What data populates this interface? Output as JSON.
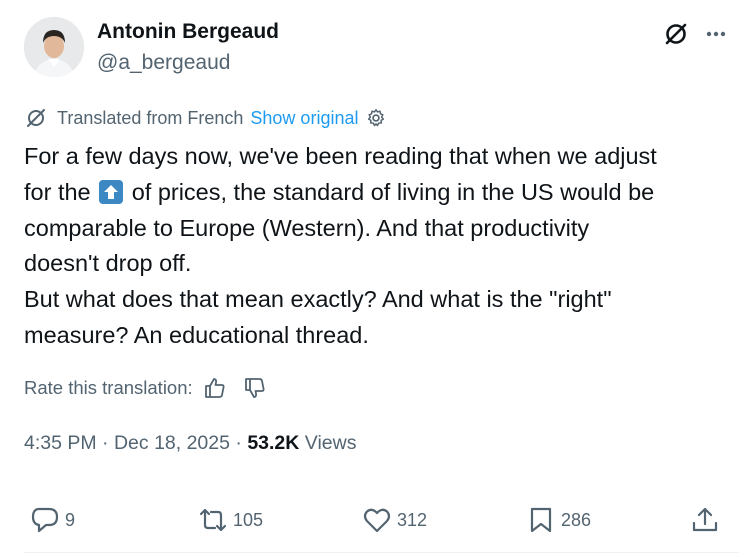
{
  "author": {
    "name": "Antonin Bergeaud",
    "handle": "@a_bergeaud"
  },
  "translation": {
    "notice": "Translated from French",
    "show_original": "Show original"
  },
  "tweet": {
    "line1": "For a few days now, we've been reading that when we adjust",
    "line2_pre": "for the",
    "emoji": "up-arrow-emoji",
    "line2_post": "of prices, the standard of living in the US would be",
    "line3": "comparable to Europe (Western). And that productivity",
    "line4": "doesn't drop off.",
    "line5": "But what does that mean exactly? And what is the \"right\"",
    "line6": "measure? An educational thread."
  },
  "rate": {
    "label": "Rate this translation:"
  },
  "meta": {
    "time": "4:35 PM",
    "sep1": "·",
    "date": "Dec 18, 2025",
    "sep2": "·",
    "views_count": "53.2K",
    "views_label": "Views"
  },
  "actions": {
    "replies": "9",
    "reposts": "105",
    "likes": "312",
    "bookmarks": "286"
  },
  "icons": {
    "grok": "grok-icon",
    "more": "more-icon",
    "translate": "translate-icon",
    "settings": "gear-icon",
    "thumbs_up": "thumbs-up-icon",
    "thumbs_down": "thumbs-down-icon",
    "reply": "reply-icon",
    "repost": "repost-icon",
    "like": "heart-icon",
    "bookmark": "bookmark-icon",
    "share": "share-icon"
  },
  "colors": {
    "text": "#0f1419",
    "secondary": "#536471",
    "link": "#1d9bf0",
    "emoji_blue": "#3b88c3"
  }
}
